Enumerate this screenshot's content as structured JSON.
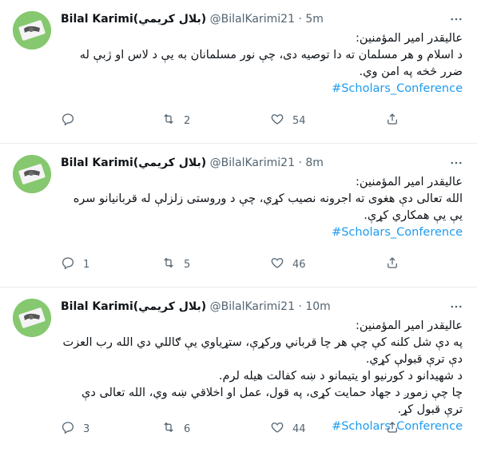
{
  "tweets": [
    {
      "name": "Bilal Karimi(بلال کريمي)",
      "handle": "@BilalKarimi21",
      "separator": "·",
      "time": "5m",
      "lines": [
        "عالیقدر امير المؤمنين:",
        "د اسلام و هر مسلمان ته دا توصيه دی، چې نور مسلمانان به يې د لاس او ژبې له ضرر څخه په امن وي."
      ],
      "hashtag": "#Scholars_Conference",
      "reply_count": "",
      "retweet_count": "2",
      "like_count": "54"
    },
    {
      "name": "Bilal Karimi(بلال کريمي)",
      "handle": "@BilalKarimi21",
      "separator": "·",
      "time": "8m",
      "lines": [
        "عالیقدر امير المؤمنين:",
        "الله تعالی دې هغوی ته اجرونه نصیب کړي، چې د وروستی زلزلې له قربانیانو سره یې يې همکاري کړې."
      ],
      "hashtag": "#Scholars_Conference",
      "reply_count": "1",
      "retweet_count": "5",
      "like_count": "46"
    },
    {
      "name": "Bilal Karimi(بلال کريمي)",
      "handle": "@BilalKarimi21",
      "separator": "·",
      "time": "10m",
      "lines": [
        "عالیقدر امير المؤمنين:",
        "په دې شل کلنه کې چې هر چا قرباني ورکړې، ستړياوي يې ګاللي دي الله رب العزت دې ترې قبولې کړي.",
        "د شهیدانو د کورنيو او يتيمانو د ښه کفالت هيله لرم.",
        "چا چې زموږ د جهاد حمايت کړی، په قول، عمل او اخلاقي ښه وي، الله تعالی دې ترې قبول کړ."
      ],
      "hashtag": "#Scholars_Conference",
      "reply_count": "3",
      "retweet_count": "6",
      "like_count": "44"
    }
  ]
}
